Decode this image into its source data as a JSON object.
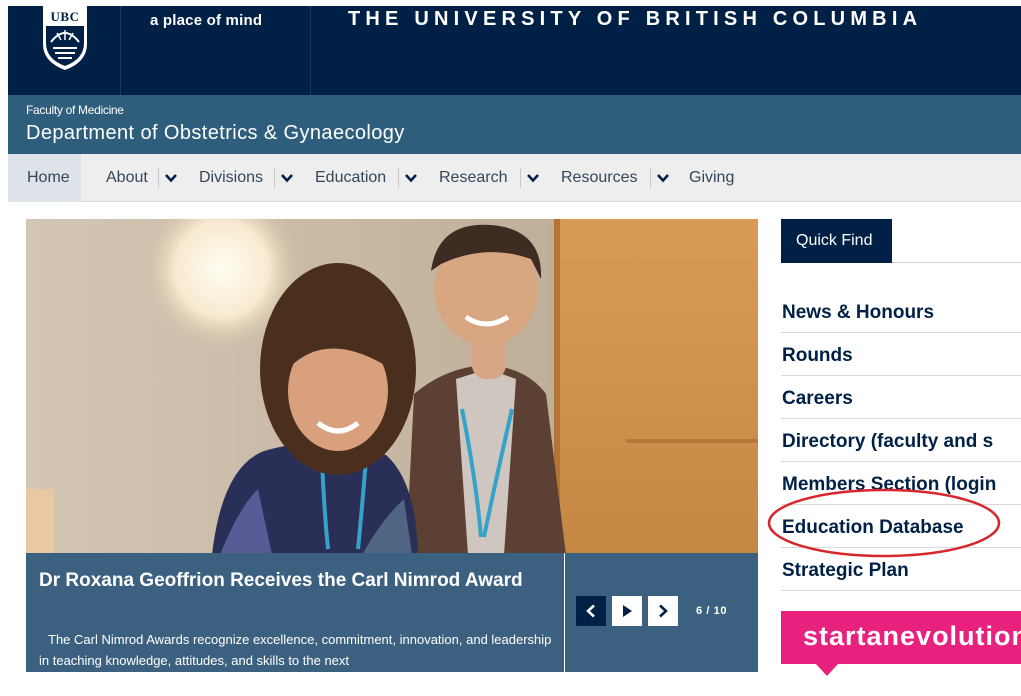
{
  "header": {
    "logo_text": "UBC",
    "tagline": "a place of mind",
    "university": "THE UNIVERSITY OF BRITISH COLUMBIA",
    "background_color": "#002145"
  },
  "unit": {
    "faculty": "Faculty of Medicine",
    "department": "Department of Obstetrics & Gynaecology",
    "background_color": "#2f5d7c"
  },
  "nav": {
    "items": [
      {
        "label": "Home",
        "active": true
      },
      {
        "label": "About",
        "has_dropdown": true
      },
      {
        "label": "Divisions",
        "has_dropdown": true
      },
      {
        "label": "Education",
        "has_dropdown": true
      },
      {
        "label": "Research",
        "has_dropdown": true
      },
      {
        "label": "Resources",
        "has_dropdown": true
      },
      {
        "label": "Giving"
      }
    ]
  },
  "slider": {
    "title": "Dr Roxana Geoffrion Receives the Carl Nimrod Award",
    "text": "The Carl Nimrod Awards recognize excellence, commitment, innovation, and leadership in teaching knowledge, attitudes, and skills to the next",
    "counter": "6 / 10",
    "controls": [
      "chevron-left-icon",
      "play-icon",
      "chevron-right-icon"
    ]
  },
  "quick_find": {
    "tab_label": "Quick Find",
    "items": [
      {
        "label": "News & Honours"
      },
      {
        "label": "Rounds"
      },
      {
        "label": "Careers"
      },
      {
        "label": "Directory (faculty and s"
      },
      {
        "label": "Members Section (login"
      },
      {
        "label": "Education Database",
        "annotated": true
      },
      {
        "label": "Strategic Plan"
      }
    ]
  },
  "promo": {
    "text": "startanevolution",
    "color": "#e8217f"
  },
  "annotation_color": "#d9262c"
}
